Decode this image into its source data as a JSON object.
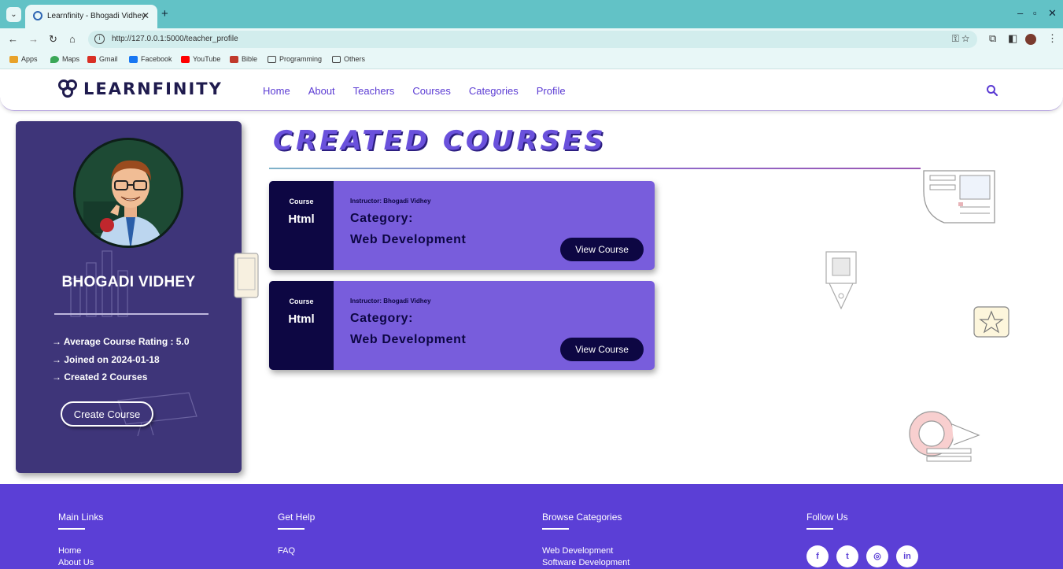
{
  "browser": {
    "tab_title": "Learnfinity - Bhogadi Vidhey",
    "url": "http://127.0.0.1:5000/teacher_profile",
    "bookmarks": [
      "Apps",
      "Maps",
      "Gmail",
      "Facebook",
      "YouTube",
      "Bible",
      "Programming",
      "Others"
    ]
  },
  "header": {
    "logo_text": "LEARNFINITY",
    "nav": [
      "Home",
      "About",
      "Teachers",
      "Courses",
      "Categories",
      "Profile"
    ]
  },
  "profile": {
    "name": "BHOGADI VIDHEY",
    "stats": [
      "→ Average Course Rating : 5.0",
      "→ Joined on 2024-01-18",
      "→ Created 2 Courses"
    ],
    "create_button": "Create Course"
  },
  "main": {
    "title": "CREATED COURSES",
    "courses": [
      {
        "label": "Course",
        "name": "Html",
        "instructor": "Instructor: Bhogadi Vidhey",
        "category_label": "Category:",
        "category": "Web Development",
        "button": "View Course"
      },
      {
        "label": "Course",
        "name": "Html",
        "instructor": "Instructor: Bhogadi Vidhey",
        "category_label": "Category:",
        "category": "Web Development",
        "button": "View Course"
      }
    ]
  },
  "footer": {
    "main_links": {
      "heading": "Main Links",
      "links": [
        "Home",
        "About Us"
      ]
    },
    "get_help": {
      "heading": "Get Help",
      "links": [
        "FAQ"
      ]
    },
    "browse": {
      "heading": "Browse Categories",
      "links": [
        "Web Development",
        "Software Development"
      ]
    },
    "follow": {
      "heading": "Follow Us",
      "icons": [
        "f",
        "t",
        "◎",
        "in"
      ]
    }
  },
  "colors": {
    "brand_purple": "#5b3fd6",
    "card_purple": "#785ddc",
    "dark_navy": "#0d0743",
    "profile_bg": "#3e3579"
  }
}
